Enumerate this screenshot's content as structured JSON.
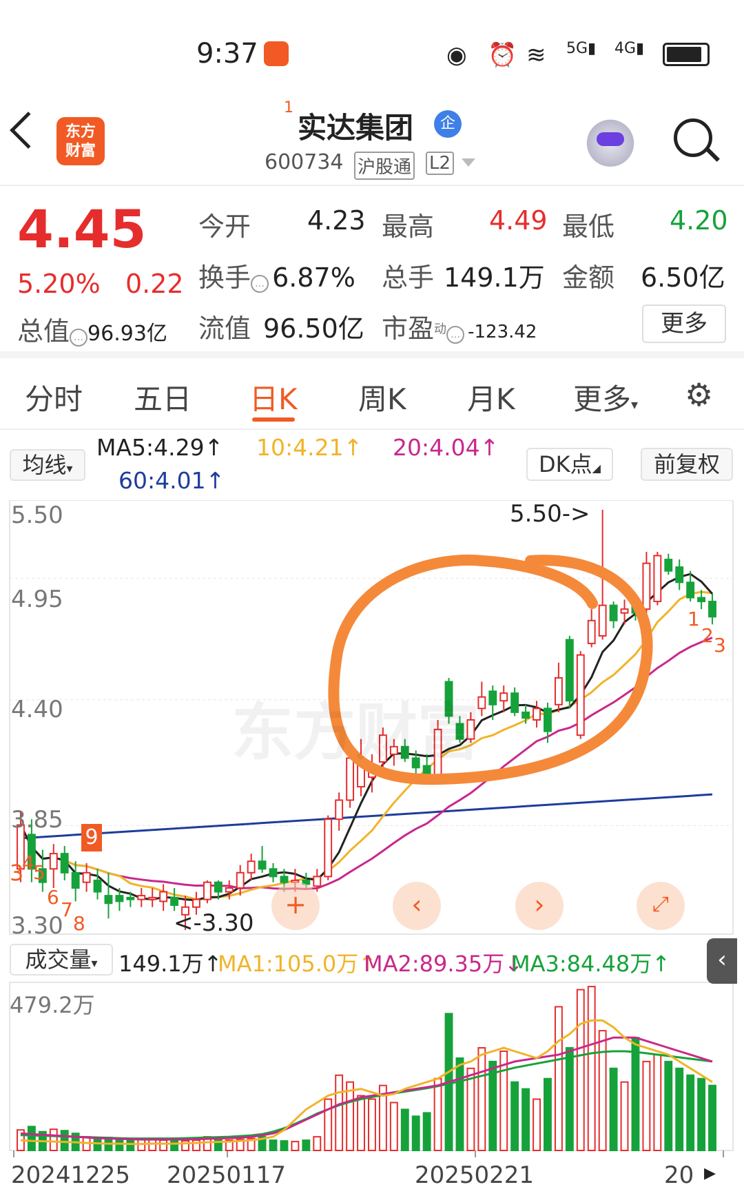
{
  "status": {
    "time": "9:37",
    "net1": "5G",
    "net2": "4G"
  },
  "header": {
    "logo": [
      "东方",
      "财富"
    ],
    "name": "实达集团",
    "sup": "1",
    "badge": "企",
    "code": "600734",
    "tags": [
      "沪股通",
      "L2"
    ]
  },
  "quote": {
    "price": "4.45",
    "pct": "5.20%",
    "change": "0.22",
    "open_label": "今开",
    "open": "4.23",
    "high_label": "最高",
    "high": "4.49",
    "low_label": "最低",
    "low": "4.20",
    "turnover_label": "换手",
    "turnover": "6.87%",
    "volume_label": "总手",
    "volume": "149.1万",
    "amount_label": "金额",
    "amount": "6.50亿",
    "mktcap_label": "总值",
    "mktcap": "96.93亿",
    "float_label": "流值",
    "float": "96.50亿",
    "pe_label": "市盈",
    "pe_sup": "动",
    "pe": "-123.42",
    "more": "更多"
  },
  "tabs": [
    "分时",
    "五日",
    "日K",
    "周K",
    "月K",
    "更多"
  ],
  "indicator": {
    "ma_button": "均线",
    "ma5": "MA5:4.29↑",
    "ma10": "10:4.21↑",
    "ma20": "20:4.04↑",
    "ma60": "60:4.01↑",
    "dk": "DK点",
    "fq": "前复权"
  },
  "price_axis": [
    "5.50",
    "4.95",
    "4.40",
    "3.85",
    "3.30"
  ],
  "annotations": {
    "high": "5.50->",
    "low": "<-3.30",
    "watermark": "东方财富",
    "seq_left": [
      "3",
      "4",
      "5",
      "6",
      "7",
      "8"
    ],
    "seq_nine": "9",
    "seq_right": [
      "1",
      "2",
      "3"
    ]
  },
  "volume": {
    "button": "成交量",
    "current": "149.1万↑",
    "ma1": "MA1:105.0万↑",
    "ma2": "MA2:89.35万↓",
    "ma3": "MA3:84.48万↑",
    "axis_top": "479.2万"
  },
  "dates": [
    "20241225",
    "20250117",
    "20250221",
    "20"
  ],
  "colors": {
    "up": "#e62d2d",
    "down": "#16a23a",
    "ma5": "#222222",
    "ma10": "#f0b428",
    "ma20": "#c8288c",
    "ma60": "#1e3c9c",
    "accent": "#f15a24",
    "circle": "#f5893a"
  },
  "chart_data": {
    "type": "candlestick",
    "y_range": [
      3.3,
      5.5
    ],
    "candles": [
      {
        "o": 3.62,
        "h": 3.92,
        "l": 3.55,
        "c": 3.85
      },
      {
        "o": 3.8,
        "h": 3.88,
        "l": 3.55,
        "c": 3.62
      },
      {
        "o": 3.62,
        "h": 3.72,
        "l": 3.5,
        "c": 3.55
      },
      {
        "o": 3.62,
        "h": 3.75,
        "l": 3.52,
        "c": 3.7
      },
      {
        "o": 3.7,
        "h": 3.74,
        "l": 3.56,
        "c": 3.6
      },
      {
        "o": 3.6,
        "h": 3.66,
        "l": 3.45,
        "c": 3.52
      },
      {
        "o": 3.55,
        "h": 3.65,
        "l": 3.5,
        "c": 3.6
      },
      {
        "o": 3.56,
        "h": 3.62,
        "l": 3.46,
        "c": 3.5
      },
      {
        "o": 3.48,
        "h": 3.6,
        "l": 3.36,
        "c": 3.44
      },
      {
        "o": 3.48,
        "h": 3.52,
        "l": 3.4,
        "c": 3.45
      },
      {
        "o": 3.47,
        "h": 3.5,
        "l": 3.42,
        "c": 3.46
      },
      {
        "o": 3.46,
        "h": 3.52,
        "l": 3.42,
        "c": 3.48
      },
      {
        "o": 3.46,
        "h": 3.52,
        "l": 3.42,
        "c": 3.47
      },
      {
        "o": 3.45,
        "h": 3.54,
        "l": 3.4,
        "c": 3.5
      },
      {
        "o": 3.47,
        "h": 3.52,
        "l": 3.4,
        "c": 3.43
      },
      {
        "o": 3.38,
        "h": 3.48,
        "l": 3.3,
        "c": 3.42
      },
      {
        "o": 3.42,
        "h": 3.5,
        "l": 3.38,
        "c": 3.46
      },
      {
        "o": 3.46,
        "h": 3.56,
        "l": 3.44,
        "c": 3.55
      },
      {
        "o": 3.55,
        "h": 3.56,
        "l": 3.46,
        "c": 3.5
      },
      {
        "o": 3.5,
        "h": 3.56,
        "l": 3.46,
        "c": 3.52
      },
      {
        "o": 3.52,
        "h": 3.64,
        "l": 3.48,
        "c": 3.6
      },
      {
        "o": 3.6,
        "h": 3.7,
        "l": 3.56,
        "c": 3.66
      },
      {
        "o": 3.66,
        "h": 3.74,
        "l": 3.6,
        "c": 3.62
      },
      {
        "o": 3.62,
        "h": 3.65,
        "l": 3.55,
        "c": 3.58
      },
      {
        "o": 3.58,
        "h": 3.62,
        "l": 3.5,
        "c": 3.55
      },
      {
        "o": 3.55,
        "h": 3.62,
        "l": 3.5,
        "c": 3.56
      },
      {
        "o": 3.56,
        "h": 3.6,
        "l": 3.52,
        "c": 3.54
      },
      {
        "o": 3.53,
        "h": 3.62,
        "l": 3.5,
        "c": 3.58
      },
      {
        "o": 3.58,
        "h": 3.9,
        "l": 3.56,
        "c": 3.88
      },
      {
        "o": 3.88,
        "h": 4.02,
        "l": 3.82,
        "c": 3.98
      },
      {
        "o": 3.98,
        "h": 4.24,
        "l": 3.94,
        "c": 4.2
      },
      {
        "o": 4.05,
        "h": 4.3,
        "l": 4.0,
        "c": 4.18
      },
      {
        "o": 4.1,
        "h": 4.22,
        "l": 4.02,
        "c": 4.16
      },
      {
        "o": 4.18,
        "h": 4.36,
        "l": 4.14,
        "c": 4.32
      },
      {
        "o": 4.22,
        "h": 4.3,
        "l": 4.16,
        "c": 4.26
      },
      {
        "o": 4.26,
        "h": 4.3,
        "l": 4.18,
        "c": 4.2
      },
      {
        "o": 4.2,
        "h": 4.24,
        "l": 4.12,
        "c": 4.15
      },
      {
        "o": 4.16,
        "h": 4.22,
        "l": 4.1,
        "c": 4.12
      },
      {
        "o": 4.1,
        "h": 4.4,
        "l": 4.08,
        "c": 4.35
      },
      {
        "o": 4.6,
        "h": 4.62,
        "l": 4.38,
        "c": 4.42
      },
      {
        "o": 4.38,
        "h": 4.42,
        "l": 4.28,
        "c": 4.3
      },
      {
        "o": 4.3,
        "h": 4.44,
        "l": 4.28,
        "c": 4.4
      },
      {
        "o": 4.46,
        "h": 4.6,
        "l": 4.42,
        "c": 4.52
      },
      {
        "o": 4.55,
        "h": 4.58,
        "l": 4.4,
        "c": 4.48
      },
      {
        "o": 4.5,
        "h": 4.58,
        "l": 4.44,
        "c": 4.54
      },
      {
        "o": 4.54,
        "h": 4.57,
        "l": 4.42,
        "c": 4.44
      },
      {
        "o": 4.44,
        "h": 4.48,
        "l": 4.38,
        "c": 4.41
      },
      {
        "o": 4.4,
        "h": 4.5,
        "l": 4.36,
        "c": 4.46
      },
      {
        "o": 4.46,
        "h": 4.49,
        "l": 4.28,
        "c": 4.34
      },
      {
        "o": 4.48,
        "h": 4.7,
        "l": 4.44,
        "c": 4.62
      },
      {
        "o": 4.82,
        "h": 4.84,
        "l": 4.46,
        "c": 4.5
      },
      {
        "o": 4.32,
        "h": 4.76,
        "l": 4.3,
        "c": 4.74
      },
      {
        "o": 4.8,
        "h": 4.98,
        "l": 4.78,
        "c": 4.92
      },
      {
        "o": 4.84,
        "h": 5.5,
        "l": 4.82,
        "c": 5.0
      },
      {
        "o": 5.0,
        "h": 5.02,
        "l": 4.88,
        "c": 4.92
      },
      {
        "o": 4.96,
        "h": 5.03,
        "l": 4.9,
        "c": 4.98
      },
      {
        "o": 5.0,
        "h": 5.06,
        "l": 4.92,
        "c": 4.96
      },
      {
        "o": 4.98,
        "h": 5.28,
        "l": 4.96,
        "c": 5.22
      },
      {
        "o": 5.02,
        "h": 5.28,
        "l": 5.0,
        "c": 5.26
      },
      {
        "o": 5.24,
        "h": 5.27,
        "l": 5.16,
        "c": 5.18
      },
      {
        "o": 5.2,
        "h": 5.24,
        "l": 5.08,
        "c": 5.12
      },
      {
        "o": 5.12,
        "h": 5.18,
        "l": 5.02,
        "c": 5.04
      },
      {
        "o": 5.04,
        "h": 5.08,
        "l": 4.98,
        "c": 5.02
      },
      {
        "o": 5.02,
        "h": 5.06,
        "l": 4.9,
        "c": 4.94
      }
    ],
    "volume": [
      60,
      70,
      55,
      62,
      58,
      50,
      40,
      36,
      38,
      34,
      30,
      32,
      34,
      30,
      36,
      28,
      30,
      40,
      36,
      30,
      32,
      35,
      40,
      30,
      28,
      26,
      30,
      40,
      150,
      220,
      200,
      160,
      150,
      190,
      140,
      120,
      100,
      110,
      210,
      400,
      270,
      240,
      300,
      260,
      290,
      200,
      180,
      150,
      210,
      420,
      300,
      470,
      479,
      350,
      240,
      200,
      330,
      260,
      280,
      260,
      240,
      220,
      210,
      190
    ],
    "volume_ma1": [
      30,
      28,
      27,
      26,
      25,
      24,
      22,
      21,
      20,
      20,
      19,
      19,
      20,
      20,
      20,
      21,
      22,
      24,
      25,
      26,
      28,
      30,
      34,
      40,
      60,
      90,
      120,
      140,
      160,
      170,
      175,
      180,
      170,
      160,
      165,
      180,
      190,
      200,
      210,
      230,
      250,
      260,
      280,
      290,
      300,
      290,
      280,
      270,
      290,
      320,
      340,
      370,
      380,
      380,
      360,
      330,
      310,
      300,
      290,
      280,
      260,
      240,
      220,
      200
    ],
    "volume_ma2": [
      50,
      48,
      46,
      44,
      42,
      40,
      38,
      36,
      35,
      34,
      33,
      32,
      32,
      32,
      32,
      32,
      33,
      34,
      35,
      36,
      37,
      40,
      44,
      50,
      60,
      75,
      90,
      105,
      120,
      135,
      145,
      155,
      160,
      165,
      170,
      175,
      180,
      185,
      190,
      200,
      210,
      220,
      230,
      240,
      250,
      260,
      265,
      270,
      275,
      280,
      290,
      300,
      310,
      320,
      330,
      330,
      330,
      320,
      310,
      300,
      290,
      280,
      270,
      260
    ],
    "volume_ma3": [
      45,
      44,
      43,
      42,
      41,
      40,
      39,
      38,
      37,
      36,
      35,
      35,
      35,
      35,
      35,
      36,
      37,
      38,
      39,
      40,
      42,
      44,
      48,
      55,
      65,
      78,
      92,
      108,
      120,
      132,
      142,
      150,
      156,
      162,
      167,
      172,
      177,
      182,
      188,
      195,
      202,
      210,
      218,
      226,
      234,
      242,
      248,
      254,
      260,
      266,
      272,
      278,
      284,
      288,
      290,
      290,
      288,
      284,
      280,
      276,
      272,
      268,
      264,
      260
    ]
  }
}
